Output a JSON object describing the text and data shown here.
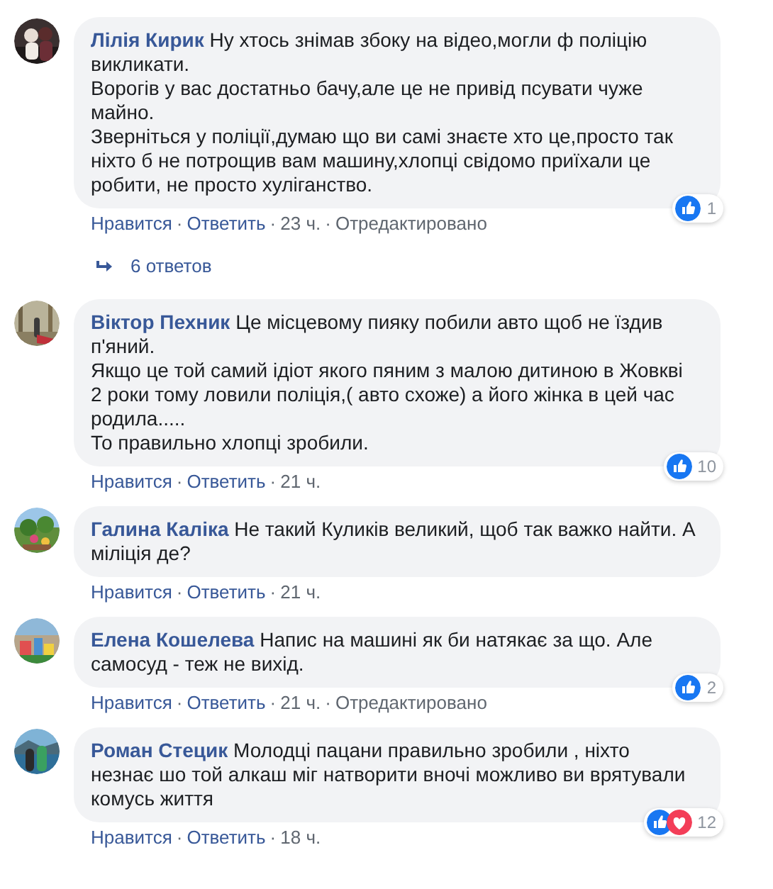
{
  "comments": [
    {
      "author": "Лілія Кирик",
      "paragraphs": [
        "Ну хтось знімав збоку на відео,могли ф поліцію викликати.",
        "Ворогів у вас достатньо бачу,але це не привід псувати чуже майно.",
        "Зверніться у поліції,думаю що ви самі знаєте хто це,просто так ніхто б не потрощив вам машину,хлопці свідомо приїхали це робити, не просто хуліганство."
      ],
      "reactions": {
        "like": true,
        "love": false,
        "count": "1"
      },
      "actions": [
        {
          "kind": "link",
          "label": "Нравится"
        },
        {
          "kind": "link",
          "dot": "·",
          "label": "Ответить"
        },
        {
          "kind": "time",
          "dot": "·",
          "label": "23 ч."
        },
        {
          "kind": "note",
          "dot": "·",
          "label": "Отредактировано"
        }
      ],
      "replies": "6 ответов"
    },
    {
      "author": "Віктор Пехник",
      "paragraphs": [
        "Це місцевому пияку побили авто щоб не їздив п'яний.",
        "Якщо це той самий ідіот якого пяним з малою дитиною в Жовкві 2 роки тому ловили поліція,( авто схоже) а його жінка в цей час родила.....",
        "То правильно хлопці зробили."
      ],
      "reactions": {
        "like": true,
        "love": false,
        "count": "10"
      },
      "actions": [
        {
          "kind": "link",
          "label": "Нравится"
        },
        {
          "kind": "link",
          "dot": "·",
          "label": "Ответить"
        },
        {
          "kind": "time",
          "dot": "·",
          "label": "21 ч."
        }
      ]
    },
    {
      "author": "Галина Каліка",
      "paragraphs": [
        "Не такий Куликів великий, щоб так важко найти. А міліція де?"
      ],
      "actions": [
        {
          "kind": "link",
          "label": "Нравится"
        },
        {
          "kind": "link",
          "dot": "·",
          "label": "Ответить"
        },
        {
          "kind": "time",
          "dot": "·",
          "label": "21 ч."
        }
      ]
    },
    {
      "author": "Елена Кошелева",
      "paragraphs": [
        "Напис на машині як би натякає за що. Але самосуд - теж не вихід."
      ],
      "reactions": {
        "like": true,
        "love": false,
        "count": "2"
      },
      "actions": [
        {
          "kind": "link",
          "label": "Нравится"
        },
        {
          "kind": "link",
          "dot": "·",
          "label": "Ответить"
        },
        {
          "kind": "time",
          "dot": "·",
          "label": "21 ч."
        },
        {
          "kind": "note",
          "dot": "·",
          "label": "Отредактировано"
        }
      ]
    },
    {
      "author": "Роман Стецик",
      "paragraphs": [
        "Молодці пацани правильно зробили , ніхто незнає шо той алкаш міг натворити вночі можливо ви врятували комусь життя"
      ],
      "reactions": {
        "like": true,
        "love": true,
        "count": "12"
      },
      "actions": [
        {
          "kind": "link",
          "label": "Нравится"
        },
        {
          "kind": "link",
          "dot": "·",
          "label": "Ответить"
        },
        {
          "kind": "time",
          "dot": "·",
          "label": "18 ч."
        }
      ]
    }
  ]
}
